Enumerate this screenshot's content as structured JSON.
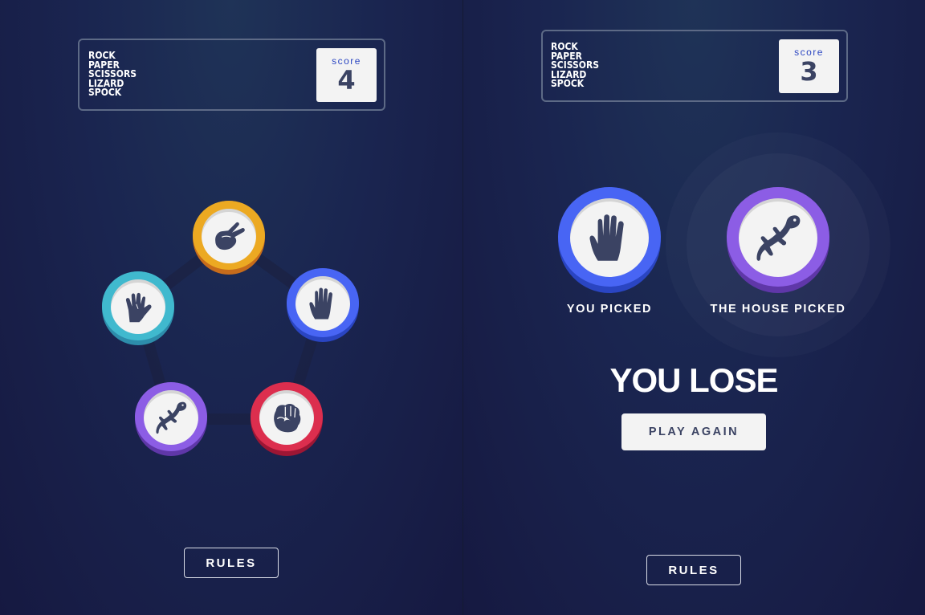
{
  "left": {
    "title_lines": [
      "ROCK",
      "PAPER",
      "SCISSORS",
      "LIZARD",
      "SPOCK"
    ],
    "score_label": "score",
    "score_value": "4",
    "tokens": [
      {
        "name": "scissors",
        "icon": "scissors-hand-icon",
        "color": "#eca922",
        "shadow": "#c76c1b"
      },
      {
        "name": "paper",
        "icon": "open-hand-icon",
        "color": "#4865f4",
        "shadow": "#2a45c2"
      },
      {
        "name": "rock",
        "icon": "fist-icon",
        "color": "#dc2e4e",
        "shadow": "#9d1634"
      },
      {
        "name": "lizard",
        "icon": "lizard-icon",
        "color": "#8c5de5",
        "shadow": "#5f37a8"
      },
      {
        "name": "spock",
        "icon": "spock-hand-icon",
        "color": "#40b9ce",
        "shadow": "#2d8dab"
      }
    ],
    "rules_label": "RULES"
  },
  "right": {
    "title_lines": [
      "ROCK",
      "PAPER",
      "SCISSORS",
      "LIZARD",
      "SPOCK"
    ],
    "score_label": "score",
    "score_value": "3",
    "you_picked_label": "YOU PICKED",
    "house_picked_label": "THE HOUSE PICKED",
    "you_pick": {
      "name": "paper",
      "icon": "open-hand-icon",
      "color": "#4865f4",
      "shadow": "#2a45c2"
    },
    "house_pick": {
      "name": "lizard",
      "icon": "lizard-icon",
      "color": "#8c5de5",
      "shadow": "#5f37a8"
    },
    "result": "YOU LOSE",
    "play_again_label": "PLAY AGAIN",
    "rules_label": "RULES"
  },
  "colors": {
    "icon": "#3b4363",
    "score_label": "#2b46c2",
    "background_dark": "#161941",
    "background_light": "#1f3357"
  }
}
